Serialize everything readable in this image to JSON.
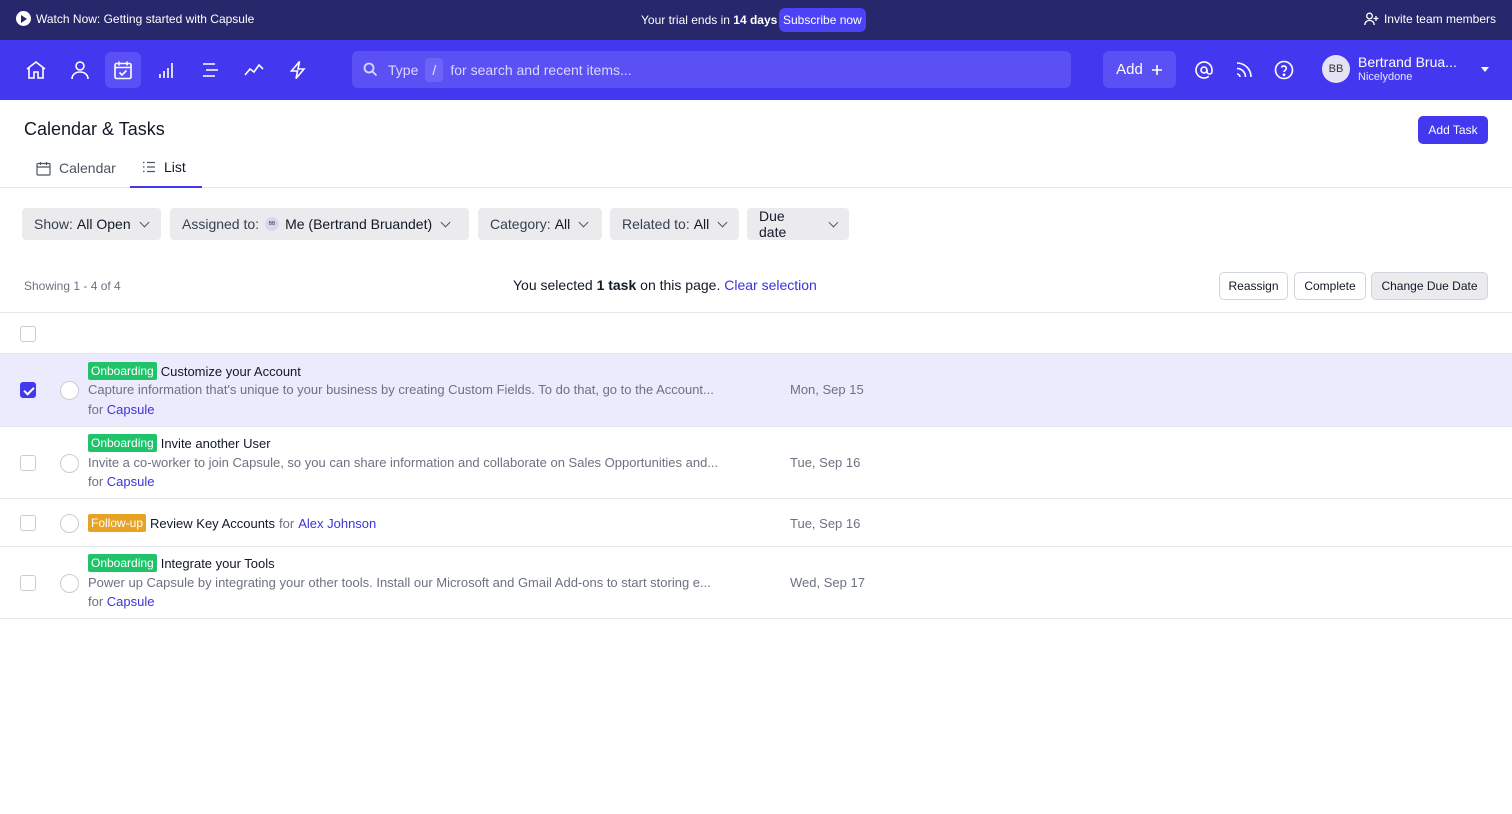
{
  "banner": {
    "watch_label": "Watch Now: Getting started with Capsule",
    "trial_prefix": "Your trial ends in",
    "trial_days": "14 days",
    "subscribe_label": "Subscribe now",
    "invite_label": "Invite team members"
  },
  "nav": {
    "icons": [
      "home-icon",
      "person-icon",
      "calendar-check-icon",
      "bar-chart-icon",
      "list-icon",
      "trend-line-icon",
      "lightning-icon"
    ],
    "active_icon": "calendar-check-icon",
    "search": {
      "prefix": "Type",
      "key": "/",
      "suffix": "for search and recent items..."
    },
    "add_label": "Add",
    "user": {
      "initials": "BB",
      "name": "Bertrand Brua...",
      "org": "Nicelydone"
    }
  },
  "page": {
    "title": "Calendar & Tasks",
    "add_task_label": "Add Task",
    "tabs": [
      {
        "label": "Calendar",
        "icon": "calendar-icon",
        "active": false
      },
      {
        "label": "List",
        "icon": "list-icon",
        "active": true
      }
    ]
  },
  "filters": {
    "show": {
      "label": "Show:",
      "value": "All Open"
    },
    "assigned": {
      "label": "Assigned to:",
      "avatar": "BB",
      "value": "Me (Bertrand Bruandet)"
    },
    "category": {
      "label": "Category:",
      "value": "All"
    },
    "related": {
      "label": "Related to:",
      "value": "All"
    },
    "sort": {
      "label": "Due date"
    }
  },
  "selection": {
    "showing": "Showing 1 - 4 of 4",
    "prefix": "You selected",
    "count": "1 task",
    "suffix": "on this page.",
    "clear_label": "Clear selection",
    "actions": [
      "Reassign",
      "Complete",
      "Change Due Date"
    ]
  },
  "tasks": [
    {
      "tag": "Onboarding",
      "title": "Customize your Account",
      "description": "Capture information that's unique to your business by creating Custom Fields. To do that, go to the Account...",
      "for_label": "for",
      "for_link": "Capsule",
      "date": "Mon, Sep 15",
      "selected": true
    },
    {
      "tag": "Onboarding",
      "title": "Invite another User",
      "description": "Invite a co-worker to join Capsule, so you can share information and collaborate on Sales Opportunities and...",
      "for_label": "for",
      "for_link": "Capsule",
      "date": "Tue, Sep 16",
      "selected": false
    },
    {
      "tag": "Follow-up",
      "title": "Review Key Accounts",
      "description": "",
      "for_label": "for",
      "for_link": "Alex Johnson",
      "date": "Tue, Sep 16",
      "selected": false
    },
    {
      "tag": "Onboarding",
      "title": "Integrate your Tools",
      "description": "Power up Capsule by integrating your other tools. Install our Microsoft and Gmail Add-ons to start storing e...",
      "for_label": "for",
      "for_link": "Capsule",
      "date": "Wed, Sep 17",
      "selected": false
    }
  ],
  "colors": {
    "banner_bg": "#27276b",
    "nav_bg": "#4338f0",
    "accent": "#4338f0",
    "tag_onboarding": "#1fc46a",
    "tag_followup": "#e9a324",
    "link": "#3b32dc"
  }
}
